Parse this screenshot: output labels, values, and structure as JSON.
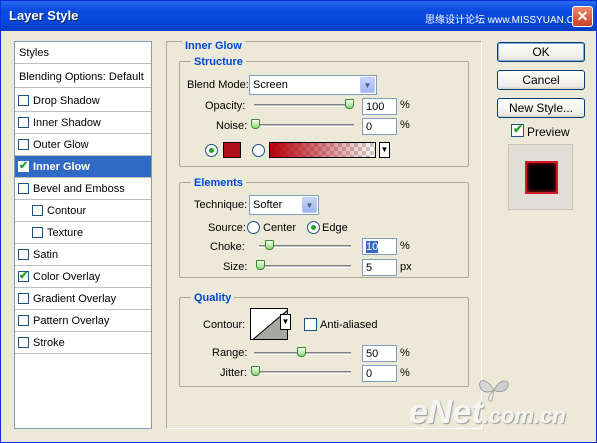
{
  "window": {
    "title": "Layer Style",
    "watermark_top": "思缘设计论坛 www.MISSYUAN.COM",
    "close": "✕"
  },
  "styles_list": {
    "header": "Styles",
    "blending": "Blending Options: Default",
    "items": [
      {
        "label": "Drop Shadow",
        "checked": false
      },
      {
        "label": "Inner Shadow",
        "checked": false
      },
      {
        "label": "Outer Glow",
        "checked": false
      },
      {
        "label": "Inner Glow",
        "checked": true
      },
      {
        "label": "Bevel and Emboss",
        "checked": false
      },
      {
        "label": "Contour",
        "checked": false
      },
      {
        "label": "Texture",
        "checked": false
      },
      {
        "label": "Satin",
        "checked": false
      },
      {
        "label": "Color Overlay",
        "checked": true
      },
      {
        "label": "Gradient Overlay",
        "checked": false
      },
      {
        "label": "Pattern Overlay",
        "checked": false
      },
      {
        "label": "Stroke",
        "checked": false
      }
    ]
  },
  "inner_glow": {
    "title": "Inner Glow",
    "structure": {
      "title": "Structure",
      "blend_mode_label": "Blend Mode:",
      "blend_mode": "Screen",
      "opacity_label": "Opacity:",
      "opacity": "100",
      "opacity_level": 1.0,
      "noise_label": "Noise:",
      "noise": "0",
      "noise_level": 0.0,
      "percent": "%",
      "glow_color": "#b0101c"
    },
    "elements": {
      "title": "Elements",
      "technique_label": "Technique:",
      "technique": "Softer",
      "source_label": "Source:",
      "source_center": "Center",
      "source_edge": "Edge",
      "source_selected": "Edge",
      "choke_label": "Choke:",
      "choke": "10",
      "choke_level": 0.1,
      "size_label": "Size:",
      "size": "5",
      "size_unit": "px",
      "percent": "%"
    },
    "quality": {
      "title": "Quality",
      "contour_label": "Contour:",
      "anti_aliased": "Anti-aliased",
      "range_label": "Range:",
      "range": "50",
      "range_level": 0.5,
      "jitter_label": "Jitter:",
      "jitter": "0",
      "jitter_level": 0.0,
      "percent": "%"
    }
  },
  "buttons": {
    "ok": "OK",
    "reset": "Cancel",
    "new_style": "New Style...",
    "preview": "Preview"
  },
  "brand": {
    "enet": "eNet",
    "domain": ".com.cn"
  }
}
